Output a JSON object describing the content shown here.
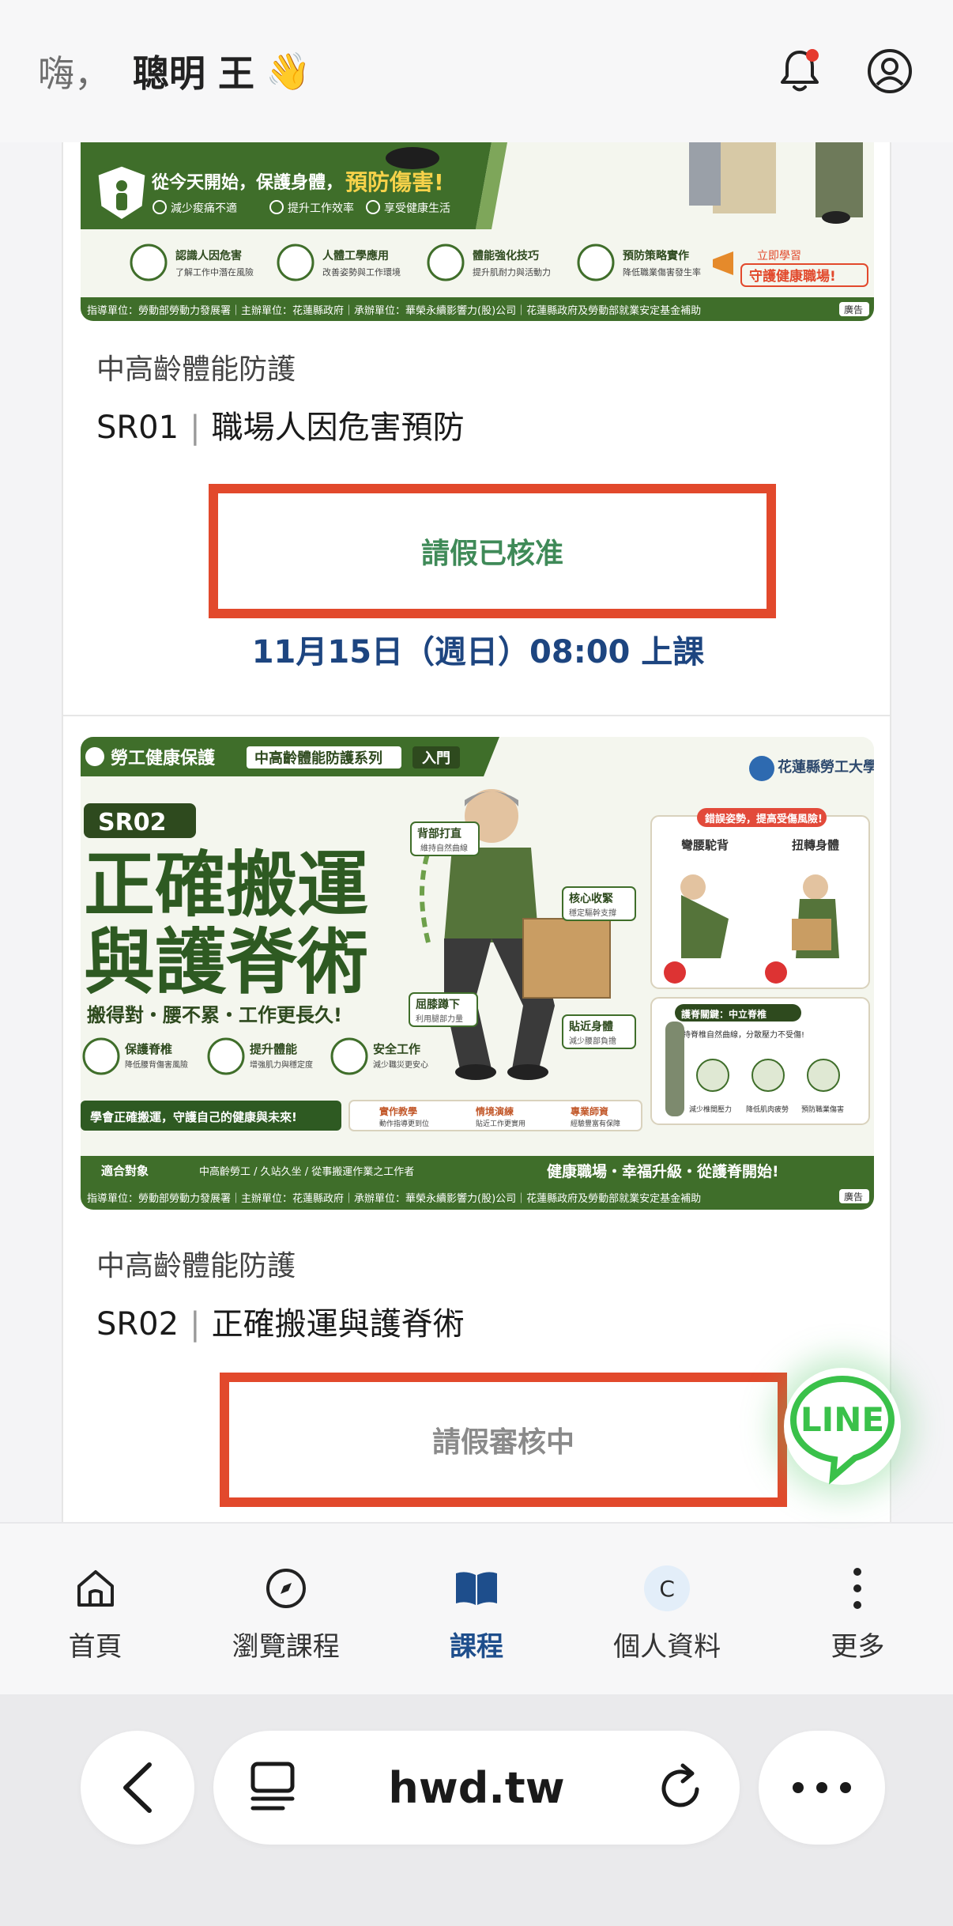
{
  "header": {
    "greeting_prefix": "嗨，",
    "user_name": "聰明 王",
    "wave_emoji": "👋",
    "icons": [
      "bell-icon",
      "user-circle-icon"
    ]
  },
  "courses": [
    {
      "category": "中高齡體能防護",
      "code": "SR01",
      "title": "職場人因危害預防",
      "status": "請假已核准",
      "class_time": "11月15日（週日）08:00 上課",
      "banner": {
        "headline_prefix": "從今天開始，保護身體，",
        "headline_highlight": "預防傷害!",
        "checks": [
          "減少痠痛不適",
          "提升工作效率",
          "享受健康生活"
        ],
        "features": [
          {
            "title": "認識人因危害",
            "sub": "了解工作中潛在風險"
          },
          {
            "title": "人體工學應用",
            "sub": "改善姿勢與工作環境"
          },
          {
            "title": "體能強化技巧",
            "sub": "提升肌耐力與活動力"
          },
          {
            "title": "預防策略實作",
            "sub": "降低職業傷害發生率"
          }
        ],
        "cta_top": "立即學習",
        "cta_bottom": "守護健康職場!",
        "footer": "指導單位：勞動部勞動力發展署｜主辦單位：花蓮縣政府｜承辦單位：華榮永續影響力(股)公司｜花蓮縣政府及勞動部就業安定基金補助",
        "ad": "廣告"
      }
    },
    {
      "category": "中高齡體能防護",
      "code": "SR02",
      "title": "正確搬運與護脊術",
      "status": "請假審核中",
      "banner": {
        "tag_left": "勞工健康保護",
        "tag_series": "中高齡體能防護系列",
        "tag_level": "入門",
        "org": "花蓮縣勞工大學",
        "code_badge": "SR02",
        "big_title_1": "正確搬運",
        "big_title_2": "與護脊術",
        "slogan": "搬得對・腰不累・工作更長久!",
        "callouts": [
          {
            "title": "背部打直",
            "sub": "維持自然曲線"
          },
          {
            "title": "核心收緊",
            "sub": "穩定驅幹支撐"
          },
          {
            "title": "屈膝蹲下",
            "sub": "利用腿部力量"
          },
          {
            "title": "貼近身體",
            "sub": "減少腰部負擔"
          }
        ],
        "benefits": [
          {
            "title": "保護脊椎",
            "sub": "降低腰背傷害風險"
          },
          {
            "title": "提升體能",
            "sub": "增強肌力與穩定度"
          },
          {
            "title": "安全工作",
            "sub": "減少職災更安心"
          }
        ],
        "wrong_header": "錯誤姿勢，提高受傷風險!",
        "wrong_1": "彎腰駝背",
        "wrong_2": "扭轉身體",
        "spine_header": "護脊關鍵：中立脊椎",
        "spine_sub": "維持脊椎自然曲線，分散壓力不受傷!",
        "spine_items": [
          "減少椎間壓力",
          "降低肌肉疲勞",
          "預防職業傷害"
        ],
        "learn_banner": "學會正確搬運，守護自己的健康與未來!",
        "methods": [
          {
            "title": "實作教學",
            "sub": "動作指導更到位"
          },
          {
            "title": "情境演練",
            "sub": "貼近工作更實用"
          },
          {
            "title": "專業師資",
            "sub": "經驗豐富有保障"
          }
        ],
        "audience_label": "適合對象",
        "audience": "中高齡勞工 / 久站久坐 / 從事搬運作業之工作者",
        "tagline": "健康職場・幸福升級・從護脊開始!",
        "footer": "指導單位：勞動部勞動力發展署｜主辦單位：花蓮縣政府｜承辦單位：華榮永續影響力(股)公司｜花蓮縣政府及勞動部就業安定基金補助",
        "ad": "廣告"
      }
    }
  ],
  "line_fab": {
    "label": "LINE"
  },
  "tabbar": {
    "items": [
      {
        "label": "首頁",
        "icon": "home-icon"
      },
      {
        "label": "瀏覽課程",
        "icon": "compass-icon"
      },
      {
        "label": "課程",
        "icon": "book-icon",
        "active": true
      },
      {
        "label": "個人資料",
        "icon": "avatar-icon",
        "avatar_letter": "C"
      },
      {
        "label": "更多",
        "icon": "more-vertical-icon"
      }
    ]
  },
  "browser": {
    "url": "hwd.tw",
    "icons": [
      "back-chevron-icon",
      "reader-icon",
      "reload-icon",
      "ellipsis-icon"
    ]
  },
  "colors": {
    "accent_blue": "#1e4e8c",
    "approved_green": "#3f8a58",
    "highlight_red": "#e2492c",
    "banner_green": "#3f6e2a"
  }
}
